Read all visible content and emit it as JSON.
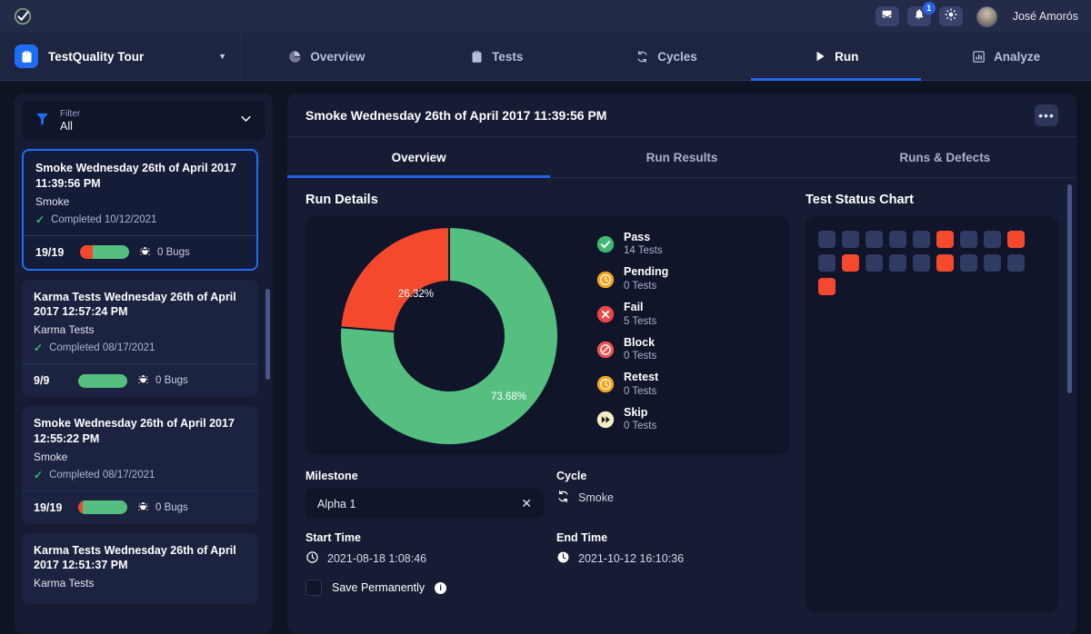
{
  "topbar": {
    "logo_icon": "check-circle-logo",
    "inbox_icon": "inbox-icon",
    "bell_icon": "bell-icon",
    "notification_count": "1",
    "theme_icon": "sun-icon",
    "username": "José Amorós"
  },
  "nav": {
    "project_icon": "clipboard-check-icon",
    "project_name": "TestQuality Tour",
    "caret_icon": "chevron-down-icon",
    "tabs": [
      {
        "label": "Overview",
        "icon": "pie-chart-icon",
        "active": false
      },
      {
        "label": "Tests",
        "icon": "clipboard-check-icon",
        "active": false
      },
      {
        "label": "Cycles",
        "icon": "refresh-cycle-icon",
        "active": false
      },
      {
        "label": "Run",
        "icon": "play-icon",
        "active": true
      },
      {
        "label": "Analyze",
        "icon": "bar-chart-icon",
        "active": false
      }
    ]
  },
  "sidebar": {
    "filter": {
      "icon": "filter-funnel-icon",
      "label": "Filter",
      "value": "All",
      "chevron_icon": "chevron-down-icon"
    },
    "cards": [
      {
        "title": "Smoke Wednesday 26th of April 2017 11:39:56 PM",
        "subtitle": "Smoke",
        "status": "Completed 10/12/2021",
        "ratio": "19/19",
        "bugs": "0 Bugs",
        "fail_pct": 26.32,
        "selected": true
      },
      {
        "title": "Karma Tests Wednesday 26th of April 2017 12:57:24 PM",
        "subtitle": "Karma Tests",
        "status": "Completed 08/17/2021",
        "ratio": "9/9",
        "bugs": "0 Bugs",
        "fail_pct": 0,
        "selected": false
      },
      {
        "title": "Smoke Wednesday 26th of April 2017 12:55:22 PM",
        "subtitle": "Smoke",
        "status": "Completed 08/17/2021",
        "ratio": "19/19",
        "bugs": "0 Bugs",
        "fail_pct": 10,
        "selected": false
      },
      {
        "title": "Karma Tests Wednesday 26th of April 2017 12:51:37 PM",
        "subtitle": "Karma Tests",
        "status": "",
        "ratio": "",
        "bugs": "",
        "fail_pct": 0,
        "selected": false
      }
    ]
  },
  "main": {
    "title": "Smoke Wednesday 26th of April 2017 11:39:56 PM",
    "more_icon": "ellipsis-icon",
    "tabs": [
      {
        "label": "Overview",
        "active": true
      },
      {
        "label": "Run Results",
        "active": false
      },
      {
        "label": "Runs & Defects",
        "active": false
      }
    ],
    "run_details_title": "Run Details",
    "test_status_title": "Test Status Chart",
    "fields": {
      "milestone_label": "Milestone",
      "milestone_value": "Alpha 1",
      "milestone_clear_icon": "close-x-icon",
      "cycle_label": "Cycle",
      "cycle_value": "Smoke",
      "cycle_icon": "refresh-cycle-icon",
      "start_time_label": "Start Time",
      "start_time_value": "2021-08-18 1:08:46",
      "start_time_icon": "clock-icon",
      "end_time_label": "End Time",
      "end_time_value": "2021-10-12 16:10:36",
      "end_time_icon": "clock-filled-icon",
      "save_permanently_label": "Save Permanently",
      "info_icon": "info-icon",
      "save_permanently_checked": false
    }
  },
  "chart_data": {
    "type": "pie",
    "title": "Run Details",
    "subtype": "donut",
    "categories": [
      "Pass",
      "Fail"
    ],
    "values": [
      73.68,
      26.32
    ],
    "value_labels": [
      "73.68%",
      "26.32%"
    ],
    "colors": [
      "#55bf80",
      "#f4492d"
    ],
    "legend_position": "right",
    "legend": [
      {
        "name": "Pass",
        "count": "14 Tests",
        "value": 14,
        "color": "#3fb96f",
        "icon": "check-circle-icon"
      },
      {
        "name": "Pending",
        "count": "0 Tests",
        "value": 0,
        "color": "#f5a31a",
        "icon": "clock-circle-icon"
      },
      {
        "name": "Fail",
        "count": "5 Tests",
        "value": 5,
        "color": "#ef4444",
        "icon": "x-circle-icon"
      },
      {
        "name": "Block",
        "count": "0 Tests",
        "value": 0,
        "color": "#ef5350",
        "icon": "block-circle-icon"
      },
      {
        "name": "Retest",
        "count": "0 Tests",
        "value": 0,
        "color": "#f5a31a",
        "icon": "retest-circle-icon"
      },
      {
        "name": "Skip",
        "count": "0 Tests",
        "value": 0,
        "color": "#f5efc4",
        "icon": "skip-forward-circle-icon"
      }
    ],
    "status_grid": {
      "type": "heatmap",
      "title": "Test Status Chart",
      "total_cells": 19,
      "columns": 9,
      "pass_color": "#303a63",
      "fail_color": "#f4492d",
      "cells": [
        "pass",
        "pass",
        "pass",
        "pass",
        "pass",
        "fail",
        "pass",
        "pass",
        "fail",
        "pass",
        "fail",
        "pass",
        "pass",
        "pass",
        "fail",
        "pass",
        "pass",
        "pass",
        "fail"
      ]
    }
  }
}
